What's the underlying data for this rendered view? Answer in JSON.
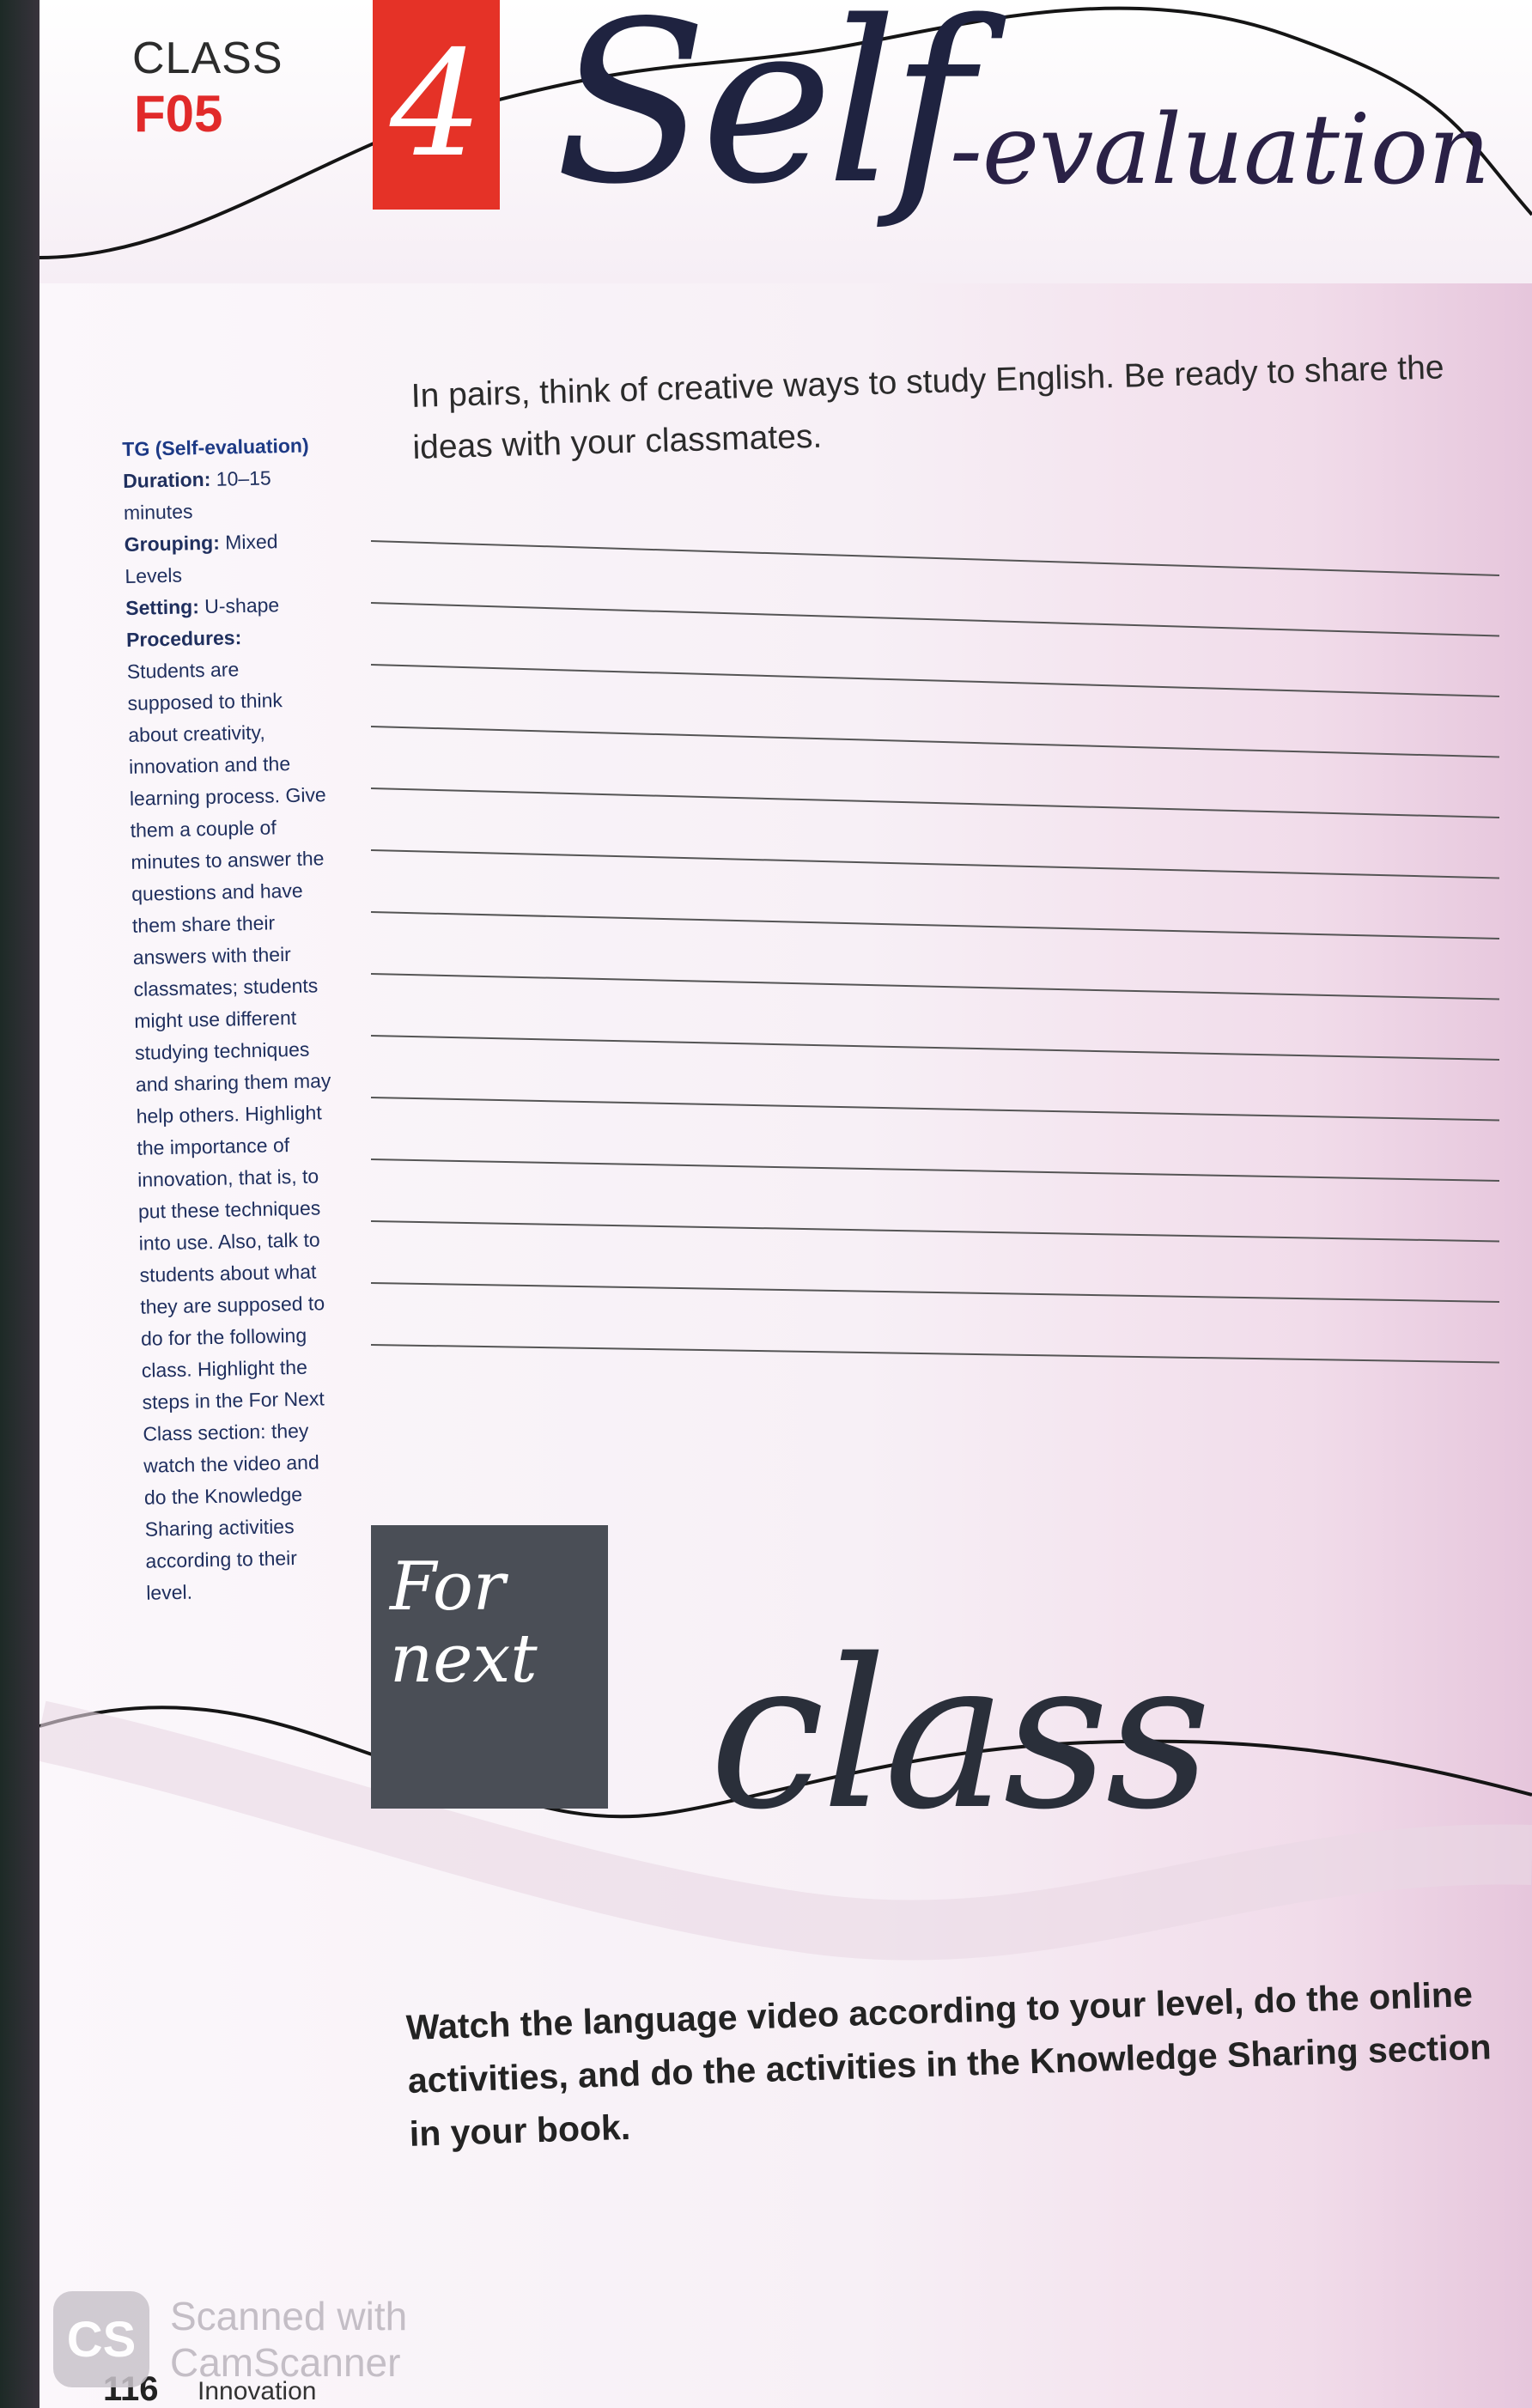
{
  "header": {
    "class_label": "CLASS",
    "class_code": "F05",
    "section_number": "4",
    "title_main": "Self",
    "title_tail": "-evaluation"
  },
  "sidebar": {
    "tg_title": "TG (Self-evaluation)",
    "duration_label": "Duration:",
    "duration_value": "10–15 minutes",
    "grouping_label": "Grouping:",
    "grouping_value": "Mixed Levels",
    "setting_label": "Setting:",
    "setting_value": "U-shape",
    "procedures_label": "Procedures:",
    "procedures_text": "Students are supposed to think about creativity, innovation and the learning process. Give them a couple of minutes to answer the questions and have them share their answers with their classmates; students might use different studying techniques and sharing them may help others. Highlight the importance of innovation, that is, to put these techniques into use. Also, talk to students about what they are supposed to do for the following class. Highlight the steps in the For Next Class section: they watch the video and do the Knowledge Sharing activities according to their level."
  },
  "activity": {
    "prompt": "In pairs, think of creative ways to study English. Be ready to share the ideas with your classmates.",
    "answer_line_count": 14
  },
  "next_class": {
    "box_text": "For next",
    "title": "class",
    "instruction": "Watch the language video according to your level, do the online activities, and do the activities in the Knowledge Sharing section in your book."
  },
  "footer": {
    "page_number": "116",
    "book_title": "Innovation"
  },
  "watermark": {
    "logo": "CS",
    "line1": "Scanned with",
    "line2": "CamScanner"
  },
  "colors": {
    "accent_red": "#e53227",
    "script_navy": "#1f2340",
    "magenta": "#8a2a5e",
    "box_gray": "#4a4e56"
  }
}
